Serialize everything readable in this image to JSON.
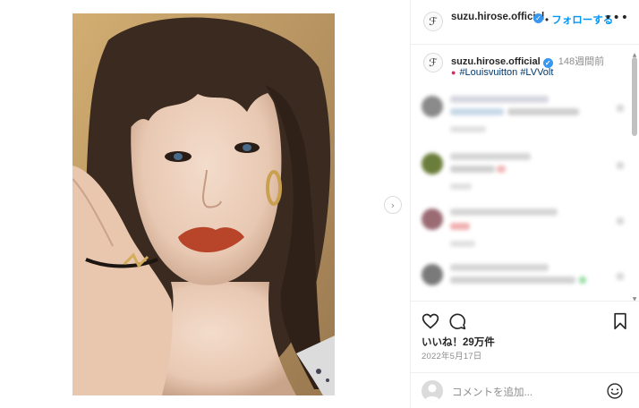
{
  "post": {
    "username": "suzu.hirose.official",
    "follow_label": "フォローする",
    "separator": "•",
    "more_label": "•••"
  },
  "caption": {
    "username": "suzu.hirose.official",
    "time": "148週間前",
    "text": "#Louisvuitton #LVVolt"
  },
  "actions": {
    "likes": "いいね！29万件",
    "date": "2022年5月17日"
  },
  "add_comment": {
    "placeholder": "コメントを追加..."
  },
  "colors": {
    "link": "#0095f6",
    "hashtag": "#00376b",
    "verified": "#3897f0"
  },
  "icons": {
    "avatar_glyph": "ℱ",
    "next": "›"
  }
}
